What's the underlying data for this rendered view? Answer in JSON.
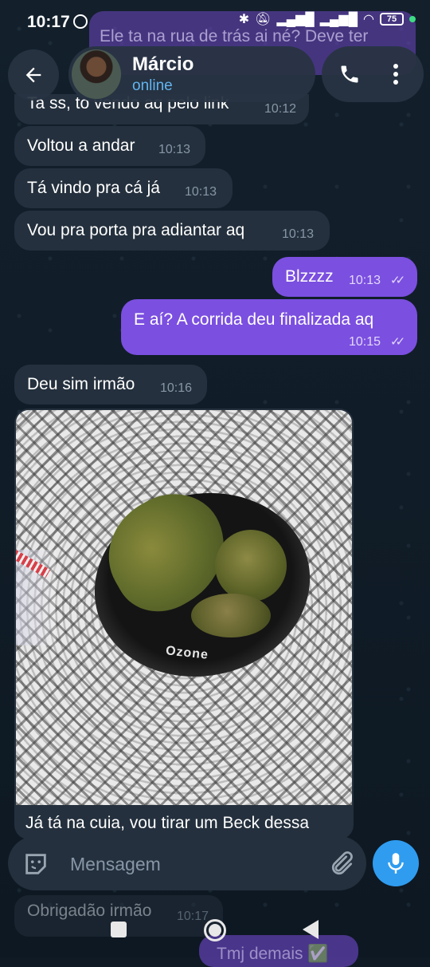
{
  "status_bar": {
    "time": "10:17",
    "battery": "75"
  },
  "ghost_message": {
    "text": "Ele ta na rua de trás ai né? Deve ter"
  },
  "header": {
    "contact_name": "Márcio",
    "contact_status": "online"
  },
  "messages": [
    {
      "direction": "in",
      "text": "Ta ss, to vendo aq pelo link",
      "time": "10:12"
    },
    {
      "direction": "in",
      "text": "Voltou a andar",
      "time": "10:13"
    },
    {
      "direction": "in",
      "text": "Tá vindo pra cá já",
      "time": "10:13"
    },
    {
      "direction": "in",
      "text": "Vou pra porta pra adiantar aq",
      "time": "10:13"
    },
    {
      "direction": "out",
      "text": "Blzzzz",
      "time": "10:13",
      "read": true
    },
    {
      "direction": "out",
      "text": "E aí? A corrida deu finalizada aq",
      "time": "10:15",
      "read": true
    },
    {
      "direction": "in",
      "text": "Deu sim irmão",
      "time": "10:16"
    }
  ],
  "photo_message": {
    "image_desc": "bowl-photo",
    "bowl_logo_text": "Ozone",
    "caption": "Já tá na cuia, vou tirar um Beck dessa"
  },
  "faded_messages": [
    {
      "direction": "in",
      "text": "Obrigadão irmão",
      "time": "10:17"
    },
    {
      "direction": "out",
      "text": "Tmj demais ✅"
    }
  ],
  "composer": {
    "placeholder": "Mensagem"
  },
  "colors": {
    "background": "#0f1a25",
    "incoming_bubble": "#24303d",
    "outgoing_bubble": "#7b4fe0",
    "accent": "#2f9cf0",
    "online": "#62b4f0"
  },
  "icons": {
    "back": "arrow-left-icon",
    "call": "phone-icon",
    "menu": "more-vertical-icon",
    "emoji": "sticker-icon",
    "attach": "paperclip-icon",
    "mic": "microphone-icon",
    "read_receipt": "double-check-icon"
  }
}
